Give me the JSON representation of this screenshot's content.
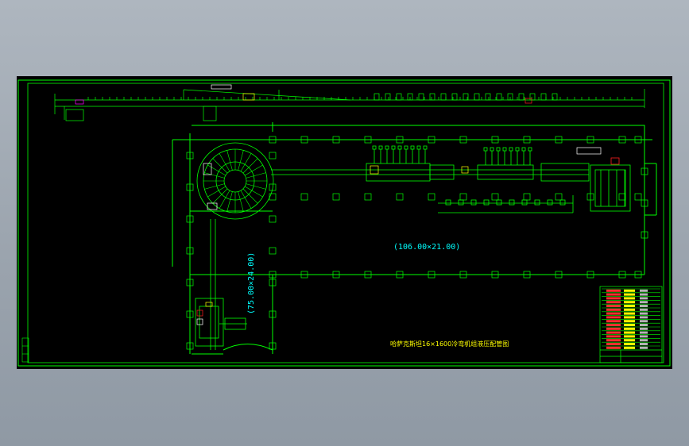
{
  "drawing": {
    "title": "哈萨克斯坦16×1600冷弯机组液压配管图",
    "dimension_main": "(106.00×21.00)",
    "dimension_side": "(75.00×24.00)",
    "colors": {
      "background": "#000000",
      "frame": "#00ff00",
      "piping": "#00ff00",
      "accent": "#ffff00",
      "highlight": "#ff2020",
      "white": "#ffffff",
      "cyan": "#00ffff",
      "magenta": "#ff00ff"
    }
  }
}
